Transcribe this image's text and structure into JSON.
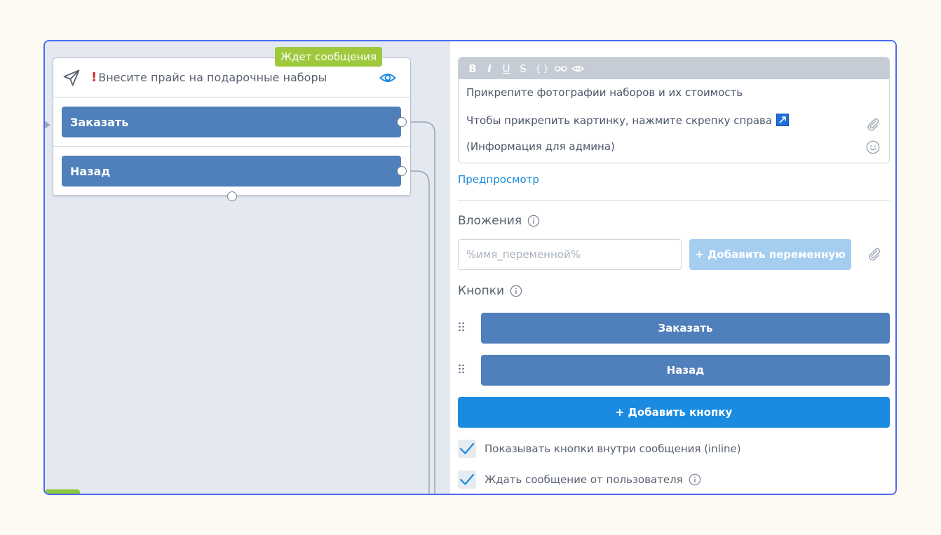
{
  "node": {
    "badge": "Ждет сообщения",
    "title_mark": "!",
    "title": "Внесите прайс на подарочные наборы",
    "buttons": [
      {
        "label": "Заказать"
      },
      {
        "label": "Назад"
      }
    ]
  },
  "editor": {
    "toolbar": {
      "bold": "B",
      "italic": "I",
      "underline": "U",
      "strike": "S",
      "code": "{ }"
    },
    "lines": [
      "Прикрепите фотографии наборов и их стоимость",
      "Чтобы прикрепить картинку, нажмите скрепку справа",
      "(Информация для админа)"
    ]
  },
  "preview_link": "Предпросмотр",
  "attachments": {
    "label": "Вложения",
    "input_placeholder": "%имя_переменной%",
    "add_variable": "+ Добавить переменную"
  },
  "buttons_section": {
    "label": "Кнопки",
    "items": [
      {
        "label": "Заказать"
      },
      {
        "label": "Назад"
      }
    ],
    "add_button": "+ Добавить кнопку"
  },
  "options": {
    "inline": "Показывать кнопки внутри сообщения (inline)",
    "wait_user": "Ждать сообщение от пользователя"
  },
  "colors": {
    "frame_border": "#4a6cf0",
    "badge": "#9ec93d",
    "button": "#5080bb",
    "primary": "#1a8be0",
    "primary_light": "#a4cdf0",
    "link": "#1a8be0"
  }
}
